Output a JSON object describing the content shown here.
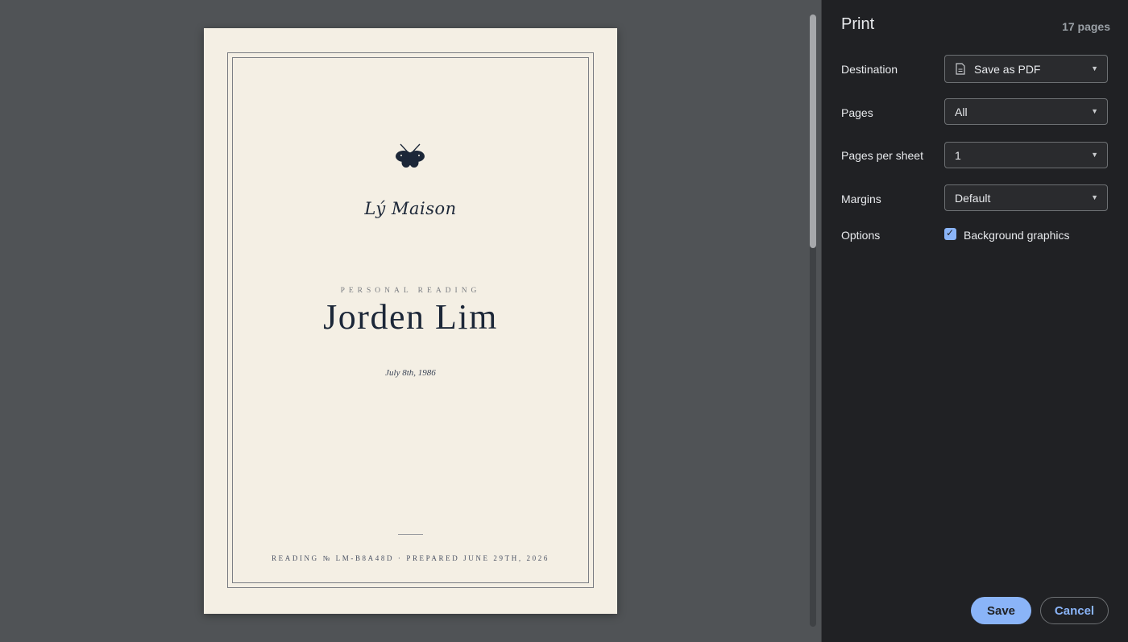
{
  "preview": {
    "brand": "Lý Maison",
    "kicker": "PERSONAL READING",
    "name": "Jorden Lim",
    "date_of_birth": "July 8th, 1986",
    "footer": "READING № LM-B8A48D · PREPARED JUNE 29TH, 2026",
    "logo_icon": "moth-icon"
  },
  "sidebar": {
    "title": "Print",
    "page_count": "17 pages",
    "destination": {
      "label": "Destination",
      "value": "Save as PDF",
      "icon": "document-icon"
    },
    "pages": {
      "label": "Pages",
      "value": "All"
    },
    "pages_per_sheet": {
      "label": "Pages per sheet",
      "value": "1"
    },
    "margins": {
      "label": "Margins",
      "value": "Default"
    },
    "options": {
      "label": "Options",
      "background_graphics": "Background graphics",
      "background_graphics_checked": true
    },
    "save_label": "Save",
    "cancel_label": "Cancel"
  },
  "colors": {
    "accent": "#8ab4f8",
    "sidebar_bg": "#202124",
    "page_bg": "#f4efe4",
    "ink": "#1c2738"
  }
}
